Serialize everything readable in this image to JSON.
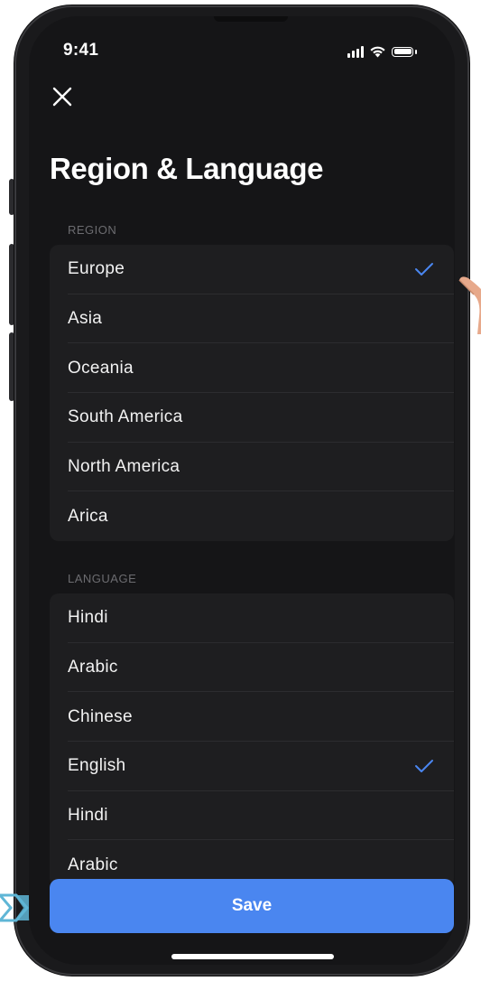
{
  "status_bar": {
    "time": "9:41"
  },
  "header": {
    "title": "Region & Language"
  },
  "region": {
    "header": "REGION",
    "items": [
      {
        "label": "Europe",
        "selected": true
      },
      {
        "label": "Asia",
        "selected": false
      },
      {
        "label": "Oceania",
        "selected": false
      },
      {
        "label": "South America",
        "selected": false
      },
      {
        "label": "North America",
        "selected": false
      },
      {
        "label": "Arica",
        "selected": false
      }
    ]
  },
  "language": {
    "header": "LANGUAGE",
    "items": [
      {
        "label": "Hindi",
        "selected": false
      },
      {
        "label": "Arabic",
        "selected": false
      },
      {
        "label": "Chinese",
        "selected": false
      },
      {
        "label": "English",
        "selected": true
      },
      {
        "label": "Hindi",
        "selected": false
      },
      {
        "label": "Arabic",
        "selected": false
      }
    ]
  },
  "footer": {
    "save_label": "Save"
  },
  "colors": {
    "accent": "#4a86f0",
    "background": "#151517",
    "card": "#1e1e20",
    "check": "#4a86f0"
  },
  "icons": {
    "close": "close-icon",
    "check": "checkmark-icon",
    "signal": "cellular-signal-icon",
    "wifi": "wifi-icon",
    "battery": "battery-icon"
  }
}
